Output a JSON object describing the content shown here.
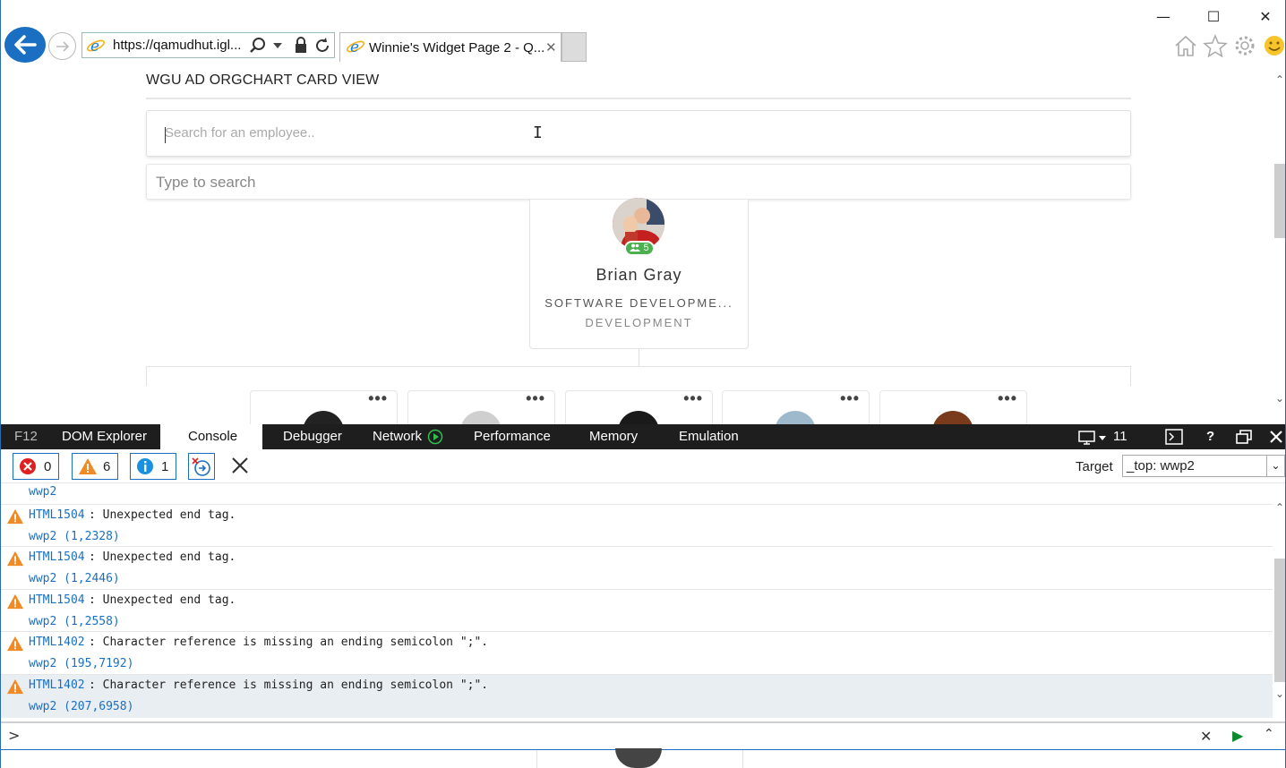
{
  "browser": {
    "address": "https://qamudhut.igl...",
    "tab_title": "Winnie's Widget Page 2 - Q...",
    "window_buttons": {
      "minimize": "—",
      "maximize": "☐",
      "close": "✕"
    }
  },
  "page": {
    "title": "WGU AD ORGCHART CARD VIEW",
    "search_placeholder": "Search for an employee..",
    "filter_placeholder": "Type to search",
    "card": {
      "name": "Brian Gray",
      "job_title": "SOFTWARE DEVELOPME...",
      "department": "DEVELOPMENT",
      "reports_count": "5"
    },
    "child_card_menu": "•••"
  },
  "devtools": {
    "f12_label": "F12",
    "tabs": [
      "DOM Explorer",
      "Console",
      "Debugger",
      "Network",
      "Performance",
      "Memory",
      "Emulation"
    ],
    "active_tab": "Console",
    "document_mode": "11",
    "counts": {
      "errors": "0",
      "warnings": "6",
      "info": "1"
    },
    "target_label": "Target",
    "target_value": "_top: wwp2",
    "console": {
      "first_line": "wwp2",
      "entries": [
        {
          "code": "HTML1504",
          "message": ": Unexpected end tag.",
          "source": "wwp2 (1,2328)"
        },
        {
          "code": "HTML1504",
          "message": ": Unexpected end tag.",
          "source": "wwp2 (1,2446)"
        },
        {
          "code": "HTML1504",
          "message": ": Unexpected end tag.",
          "source": "wwp2 (1,2558)"
        },
        {
          "code": "HTML1402",
          "message": ": Character reference is missing an ending semicolon \";\".",
          "source": "wwp2 (195,7192)"
        },
        {
          "code": "HTML1402",
          "message": ": Character reference is missing an ending semicolon \";\".",
          "source": "wwp2 (207,6958)"
        }
      ]
    },
    "prompt_symbol": ">"
  },
  "colors": {
    "accent": "#1b6fc2",
    "warning": "#f08a24",
    "error": "#e02020",
    "badge_green": "#4caf50",
    "devtools_bar": "#1e1e1e"
  },
  "icons": [
    "back-arrow-icon",
    "forward-arrow-icon",
    "ie-logo-icon",
    "search-icon",
    "lock-icon",
    "refresh-icon",
    "home-icon",
    "favorites-star-icon",
    "settings-gear-icon",
    "smiley-feedback-icon",
    "warning-triangle-icon",
    "error-circle-icon",
    "info-circle-icon",
    "clear-console-icon"
  ]
}
